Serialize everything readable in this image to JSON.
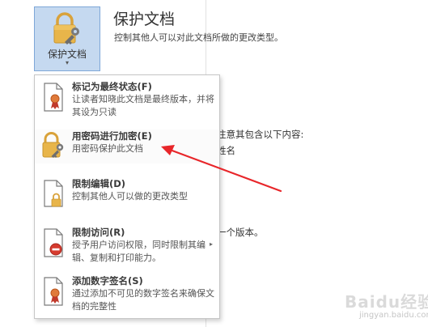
{
  "protect_button": {
    "label": "保护文档",
    "caret": "▾",
    "icon": "lock-key-icon"
  },
  "panel": {
    "title": "保护文档",
    "description": "控制其他人可以对此文档所做的更改类型。"
  },
  "background_fragments": {
    "line1": "注意其包含以下内容:",
    "line2": "姓名",
    "line3": "一个版本。"
  },
  "menu": {
    "items": [
      {
        "title": "标记为最终状态(F)",
        "desc": "让读者知晓此文档是最终版本，并将其设为只读",
        "icon": "document-ribbon-icon"
      },
      {
        "title": "用密码进行加密(E)",
        "desc": "用密码保护此文档",
        "icon": "lock-key-icon"
      },
      {
        "title": "限制编辑(D)",
        "desc": "控制其他人可以做的更改类型",
        "icon": "document-lock-icon"
      },
      {
        "title": "限制访问(R)",
        "desc": "授予用户访问权限，同时限制其编辑、复制和打印能力。",
        "icon": "document-restrict-icon",
        "submenu": "▸"
      },
      {
        "title": "添加数字签名(S)",
        "desc": "通过添加不可见的数字签名来确保文档的完整性",
        "icon": "document-signature-icon"
      }
    ]
  },
  "watermark": {
    "brand": "Baidu经验",
    "url": "jingyan.baidu.com"
  },
  "colors": {
    "button_bg": "#c5d9f0",
    "button_border": "#7ea7d8",
    "arrow": "#e8262a",
    "lock_gold": "#e8b54a",
    "ribbon_red": "#c0392b"
  }
}
